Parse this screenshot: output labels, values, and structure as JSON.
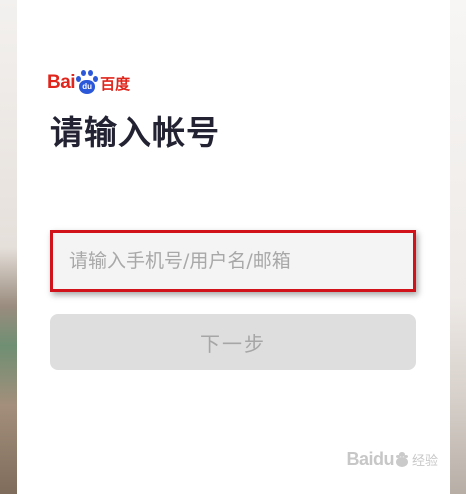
{
  "brand": {
    "logo_text_latin": "Bai",
    "logo_paw_text": "du",
    "logo_text_cn": "百度",
    "brand_color": "#e0261c",
    "paw_color": "#2b57d9"
  },
  "heading": {
    "title": "请输入帐号"
  },
  "account_field": {
    "placeholder": "请输入手机号/用户名/邮箱",
    "value": "",
    "highlight_color": "#d2121a"
  },
  "next_button": {
    "label": "下一步"
  },
  "watermark": {
    "text": "Baidu",
    "suffix": "经验"
  },
  "icons": {
    "logo": "baidu-paw-icon",
    "watermark": "baidu-paw-icon"
  }
}
